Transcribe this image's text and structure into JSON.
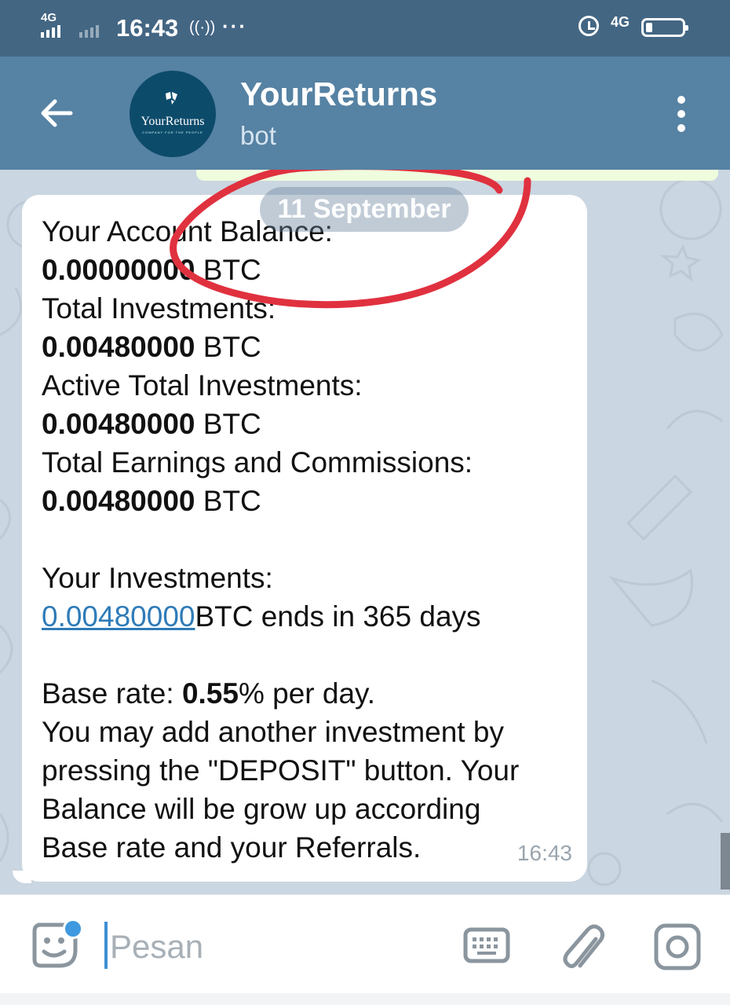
{
  "status_bar": {
    "network_label": "4G",
    "time": "16:43",
    "wifi_glyph": "((·))",
    "more_dots": "···",
    "right_network_label": "4G"
  },
  "header": {
    "title": "YourReturns",
    "subtitle": "bot",
    "avatar_text": "YourReturns",
    "avatar_subtext": "COMPANY FOR THE PEOPLE"
  },
  "chat": {
    "date_pill": "11 September",
    "message": {
      "balance_label": "Your Account Balance:",
      "balance_value": "0.00000000",
      "total_investments_label": "Total Investments:",
      "total_investments_value": "0.00480000",
      "active_total_label": "Active Total Investments:",
      "active_total_value": "0.00480000",
      "earnings_label": "Total Earnings and Commissions:",
      "earnings_value": "0.00480000",
      "currency": " BTC",
      "your_investments_label": "Your Investments:",
      "investment_link": "0.00480000",
      "investment_suffix": "BTC ends in 365 days",
      "base_rate_prefix": "Base rate: ",
      "base_rate_value": "0.55",
      "base_rate_suffix": "% per day.",
      "deposit_line_1": "You may add another investment by",
      "deposit_line_2": "pressing the \"DEPOSIT\" button. Your",
      "deposit_line_3": "Balance will be grow up according",
      "deposit_line_4": "Base rate and your Referrals.",
      "time": "16:43"
    }
  },
  "input_bar": {
    "placeholder": "Pesan"
  },
  "colors": {
    "status_bar": "#436683",
    "header": "#5682a3",
    "chat_background": "#cad6e1",
    "bubble": "#ffffff",
    "link": "#2e7bb8",
    "annotation_circle": "#e0313f",
    "accent": "#3e99e0"
  },
  "icons": [
    "back-arrow-icon",
    "more-vertical-icon",
    "sticker-emoji-icon",
    "keyboard-icon",
    "paperclip-icon",
    "camera-icon",
    "alarm-icon",
    "battery-icon",
    "signal-icon"
  ]
}
